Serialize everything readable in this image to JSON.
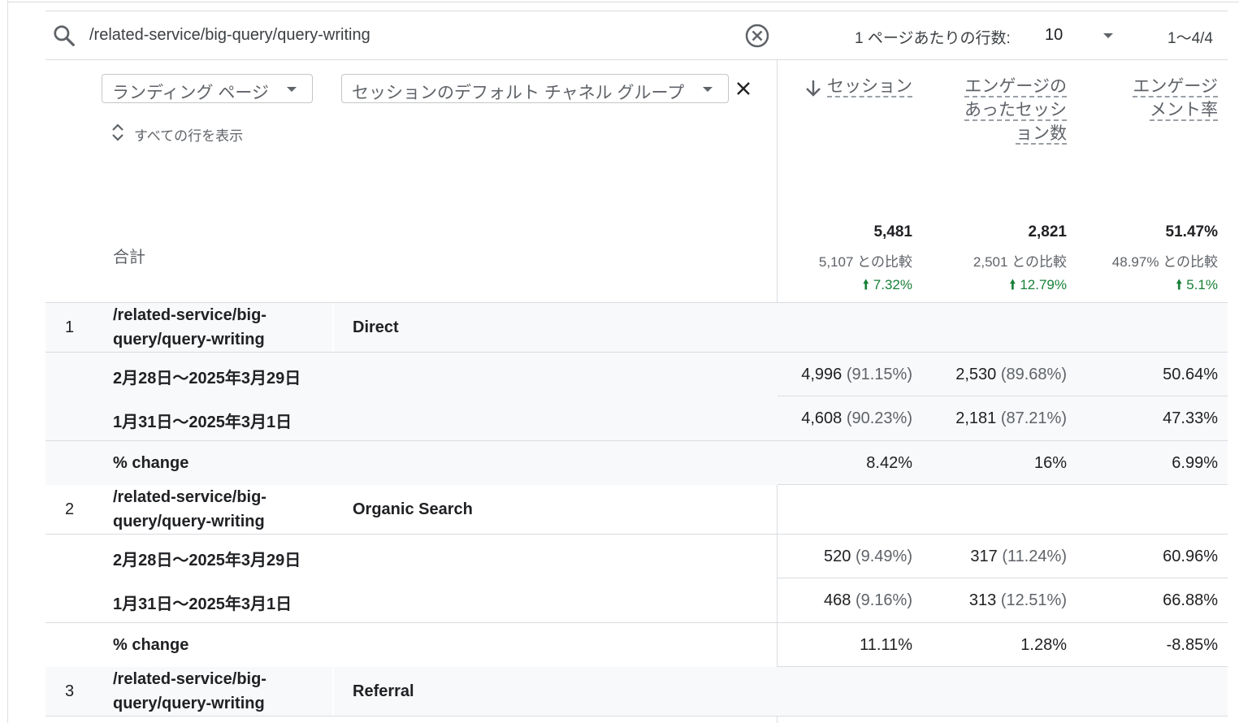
{
  "search": {
    "value": "/related-service/big-query/query-writing"
  },
  "pagination": {
    "rows_label": "1 ページあたりの行数:",
    "rows_value": "10",
    "range": "1～4/4"
  },
  "dimensions": {
    "primary": "ランディング ページ",
    "secondary": "セッションのデフォルト チャネル グループ",
    "show_all": "すべての行を表示"
  },
  "columns": {
    "sessions_line1": "セッション",
    "engaged_line1": "エンゲージの",
    "engaged_line2": "あったセッシ",
    "engaged_line3": "ョン数",
    "rate_line1": "エンゲージ",
    "rate_line2": "メント率"
  },
  "totals": {
    "label": "合計",
    "sessions": "5,481",
    "sessions_cmp": "5,107 との比較",
    "sessions_chg": "7.32%",
    "engaged": "2,821",
    "engaged_cmp": "2,501 との比較",
    "engaged_chg": "12.79%",
    "rate": "51.47%",
    "rate_cmp": "48.97% との比較",
    "rate_chg": "5.1%"
  },
  "rows": [
    {
      "num": "1",
      "page_line1": "/related-service/big-",
      "page_line2": "query/query-writing",
      "channel": "Direct",
      "p1_label": "2月28日～2025年3月29日",
      "p1_sessions": "4,996",
      "p1_sessions_pct": "(91.15%)",
      "p1_engaged": "2,530",
      "p1_engaged_pct": "(89.68%)",
      "p1_rate": "50.64%",
      "p2_label": "1月31日～2025年3月1日",
      "p2_sessions": "4,608",
      "p2_sessions_pct": "(90.23%)",
      "p2_engaged": "2,181",
      "p2_engaged_pct": "(87.21%)",
      "p2_rate": "47.33%",
      "chg_label": "% change",
      "chg_sessions": "8.42%",
      "chg_engaged": "16%",
      "chg_rate": "6.99%"
    },
    {
      "num": "2",
      "page_line1": "/related-service/big-",
      "page_line2": "query/query-writing",
      "channel": "Organic Search",
      "p1_label": "2月28日～2025年3月29日",
      "p1_sessions": "520",
      "p1_sessions_pct": "(9.49%)",
      "p1_engaged": "317",
      "p1_engaged_pct": "(11.24%)",
      "p1_rate": "60.96%",
      "p2_label": "1月31日～2025年3月1日",
      "p2_sessions": "468",
      "p2_sessions_pct": "(9.16%)",
      "p2_engaged": "313",
      "p2_engaged_pct": "(12.51%)",
      "p2_rate": "66.88%",
      "chg_label": "% change",
      "chg_sessions": "11.11%",
      "chg_engaged": "1.28%",
      "chg_rate": "-8.85%"
    },
    {
      "num": "3",
      "page_line1": "/related-service/big-",
      "page_line2": "query/query-writing",
      "channel": "Referral"
    }
  ],
  "colors": {
    "positive": "#188038",
    "band": "#f8f9fa",
    "border": "#dadce0"
  }
}
